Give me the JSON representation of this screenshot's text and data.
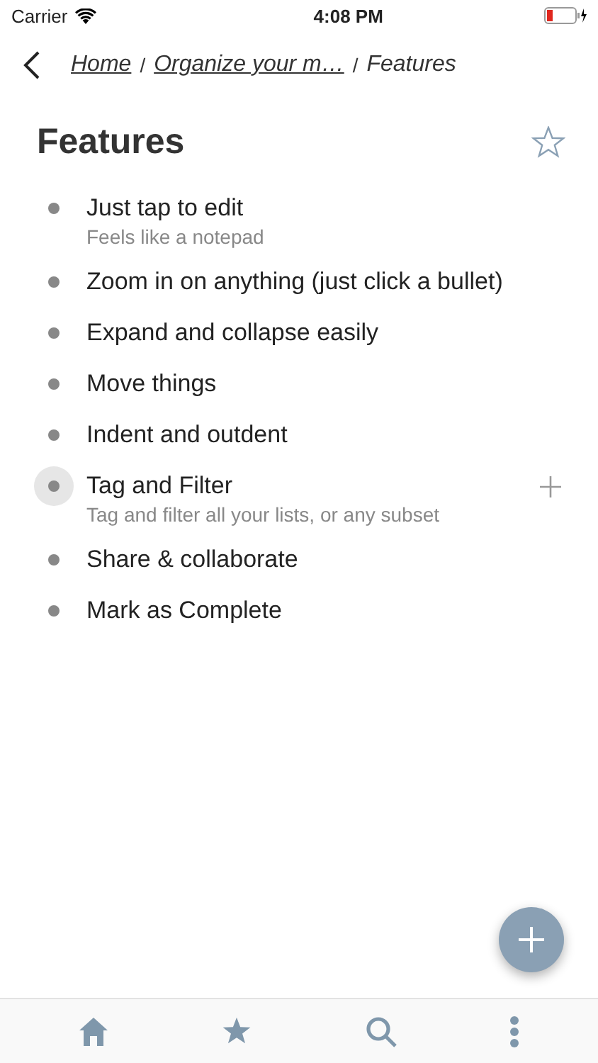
{
  "status_bar": {
    "carrier": "Carrier",
    "time": "4:08 PM"
  },
  "breadcrumb_separator": "/",
  "breadcrumb": [
    {
      "label": "Home",
      "link": true
    },
    {
      "label": "Organize your m…",
      "link": true
    },
    {
      "label": "Features",
      "link": false
    }
  ],
  "title": "Features",
  "favorite": false,
  "items": [
    {
      "text": "Just tap to edit",
      "note": "Feels like a notepad",
      "selected": false
    },
    {
      "text": "Zoom in on anything (just click a bullet)",
      "selected": false
    },
    {
      "text": "Expand and collapse easily",
      "selected": false
    },
    {
      "text": "Move things",
      "selected": false
    },
    {
      "text": "Indent and outdent",
      "selected": false
    },
    {
      "text": "Tag and Filter",
      "note": "Tag and filter all your lists, or any subset",
      "selected": true
    },
    {
      "text": "Share & collaborate",
      "selected": false
    },
    {
      "text": "Mark as Complete",
      "selected": false
    }
  ],
  "tab_bar": [
    {
      "kind": "home"
    },
    {
      "kind": "star"
    },
    {
      "kind": "search"
    },
    {
      "kind": "more"
    }
  ]
}
